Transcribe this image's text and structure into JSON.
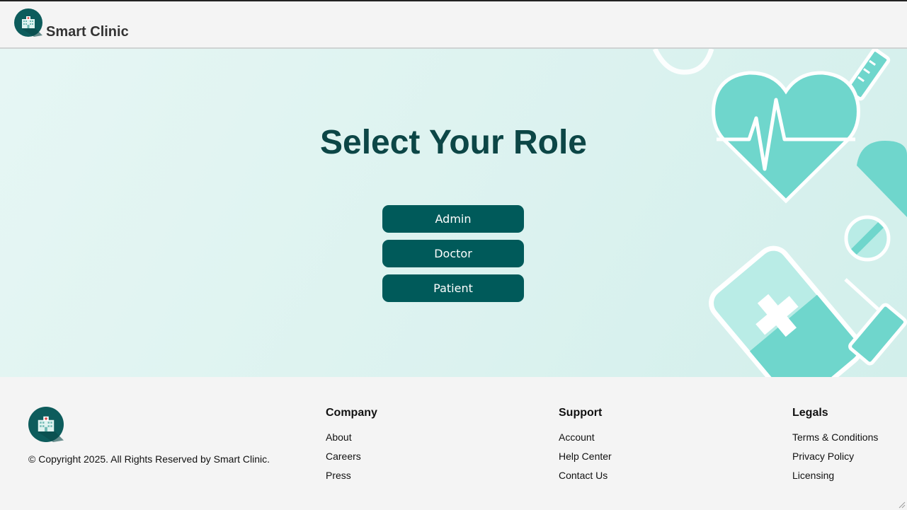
{
  "header": {
    "brand": "Smart Clinic",
    "logo_icon": "hospital-icon"
  },
  "main": {
    "title": "Select Your Role",
    "roles": [
      "Admin",
      "Doctor",
      "Patient"
    ]
  },
  "footer": {
    "copyright": "© Copyright 2025. All Rights Reserved by Smart Clinic.",
    "columns": [
      {
        "heading": "Company",
        "links": [
          "About",
          "Careers",
          "Press"
        ]
      },
      {
        "heading": "Support",
        "links": [
          "Account",
          "Help Center",
          "Contact Us"
        ]
      },
      {
        "heading": "Legals",
        "links": [
          "Terms & Conditions",
          "Privacy Policy",
          "Licensing"
        ]
      }
    ]
  },
  "colors": {
    "accent": "#005a5a",
    "title": "#0c4646",
    "hero_bg": "#dbf2ef",
    "deco": "#6fd6cc"
  }
}
